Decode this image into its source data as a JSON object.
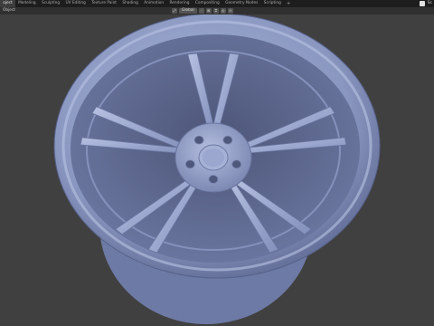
{
  "tabs": [
    "oject",
    "Modeling",
    "Sculpting",
    "UV Editing",
    "Texture Paint",
    "Shading",
    "Animation",
    "Rendering",
    "Compositing",
    "Geometry Nodes",
    "Scripting"
  ],
  "add_tab": "+",
  "scene_label": "Sc",
  "header": {
    "mode": "Object",
    "transform_orientation": "Global"
  },
  "colors": {
    "wheel": "#8a97c0",
    "background": "#404040"
  }
}
